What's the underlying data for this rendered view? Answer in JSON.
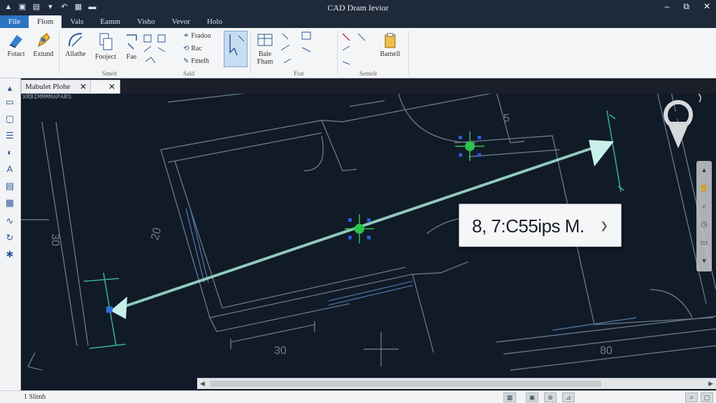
{
  "app": {
    "title": "CAD Dram Ievior"
  },
  "quick_access": [
    "cad-logo-icon",
    "new-icon",
    "open-icon",
    "save-icon",
    "undo-icon",
    "print-icon",
    "layer-icon"
  ],
  "window_controls": {
    "minimize": "–",
    "restore": "⧉",
    "close": "✕"
  },
  "tabs": [
    "File",
    "Flom",
    "Vals",
    "Eamm",
    "Visho",
    "Vevor",
    "Holo"
  ],
  "ribbon": {
    "buttons": [
      "Fotact",
      "Extund",
      "Allathe",
      "Fooject",
      "Fae",
      "Bale Fham",
      "Bamell"
    ],
    "small_items": [
      "Fradon",
      "Rac",
      "Fmelh"
    ],
    "groups": [
      "Smeit",
      "Sald",
      "Frar",
      "Semelr"
    ]
  },
  "document": {
    "tab_label": "Mabulet Plohe",
    "subpath": "XRBIMMMMAPARS"
  },
  "canvas": {
    "dimensions": [
      "30",
      "30",
      "30",
      "80",
      "20",
      "30",
      "5"
    ],
    "background": "#111a27",
    "line_color": "#6f7f92",
    "measure_color": "#8fd6c8",
    "snap_color": "#2bc44a"
  },
  "tooltip": {
    "text": "8, 7:C55ips M."
  },
  "statusbar": {
    "left": "1  Slimh"
  }
}
